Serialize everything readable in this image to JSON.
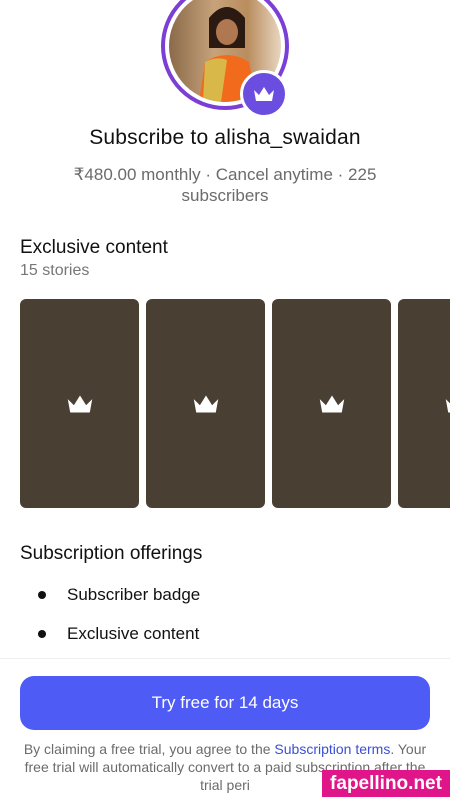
{
  "profile": {
    "title": "Subscribe to alisha_swaidan",
    "subtitle": "₹480.00 monthly · Cancel anytime · 225 subscribers"
  },
  "exclusive": {
    "heading": "Exclusive content",
    "count_label": "15 stories",
    "tile_icon": "crown-icon"
  },
  "offerings": {
    "heading": "Subscription offerings",
    "items": [
      "Subscriber badge",
      "Exclusive content"
    ]
  },
  "cta": {
    "label": "Try free for 14 days"
  },
  "legal": {
    "prefix": "By claiming a free trial, you agree to the ",
    "link_text": "Subscription terms",
    "suffix": ". Your free trial will automatically convert to a paid subscription after the trial peri"
  },
  "watermark": {
    "text": "fapellino.net"
  },
  "colors": {
    "accent": "#4f5bf5",
    "badge": "#6b4ee0",
    "ring": "#7b3fd6",
    "tile": "#4a3f33",
    "watermark": "#e0158a"
  }
}
